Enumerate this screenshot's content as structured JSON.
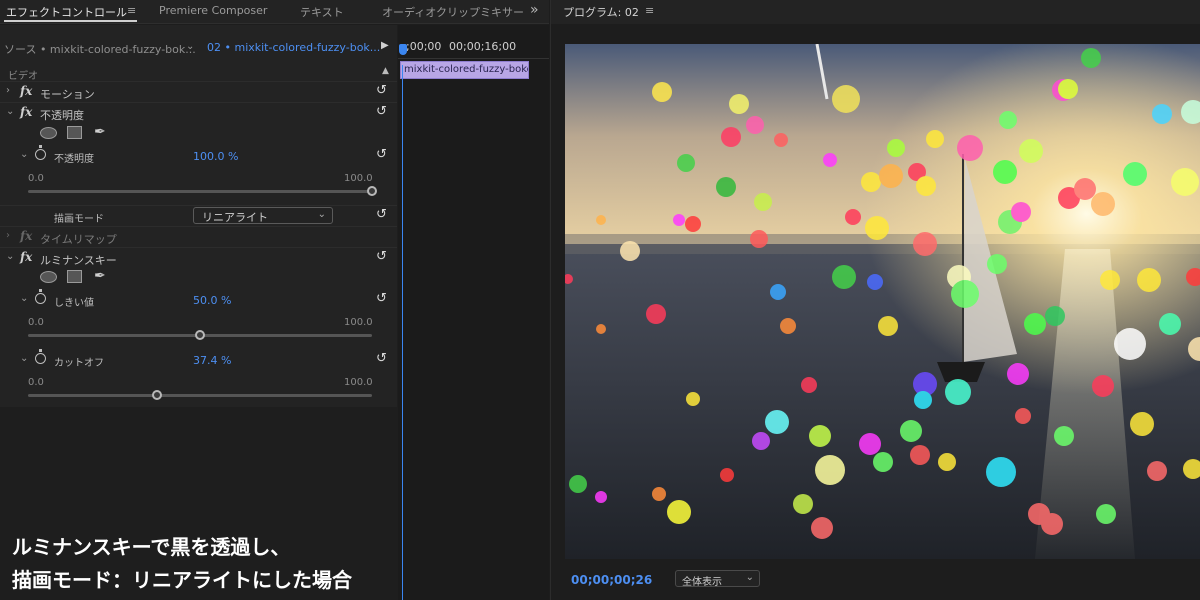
{
  "tabs": [
    {
      "label": "エフェクトコントロール",
      "active": true
    },
    {
      "label": "Premiere Composer",
      "active": false
    },
    {
      "label": "テキスト",
      "active": false
    },
    {
      "label": "オーディオクリップミキサー",
      "active": false
    }
  ],
  "icons": {
    "menu": "≡",
    "more": "»",
    "play": "▶",
    "reset": "↺",
    "chevron_down": "⌄",
    "chevron_right": "›",
    "pen": "✒"
  },
  "effects": {
    "source_label": "ソース • mixkit-colored-fuzzy-bok...",
    "sequence_label": "02 • mixkit-colored-fuzzy-bok...",
    "section_video": "ビデオ",
    "motion": "モーション",
    "opacity": {
      "title": "不透明度",
      "param": "不透明度",
      "value": "100.0 %",
      "slider": {
        "min": "0.0",
        "max": "100.0",
        "fraction": 1.0
      },
      "blend_label": "描画モード",
      "blend_value": "リニアライト"
    },
    "time_remap": "タイムリマップ",
    "luma_key": {
      "title": "ルミナンスキー",
      "threshold_label": "しきい値",
      "threshold_value": "50.0 %",
      "threshold_slider": {
        "min": "0.0",
        "max": "100.0",
        "fraction": 0.5
      },
      "cutoff_label": "カットオフ",
      "cutoff_value": "37.4 %",
      "cutoff_slider": {
        "min": "0.0",
        "max": "100.0",
        "fraction": 0.374
      }
    }
  },
  "timeline": {
    "timecode_start": ";00;00",
    "timecode_mid": "00;00;16;00",
    "clip_name": "mixkit-colored-fuzzy-boke"
  },
  "caption": {
    "line1": "ルミナンスキーで黒を透過し、",
    "line2": "描画モード：リニアライトにした場合"
  },
  "program": {
    "title": "プログラム: 02",
    "timecode": "00;00;00;26",
    "zoom": "全体表示"
  },
  "colors": {
    "accent_blue": "#4d8ff2",
    "clip": "#b8a6e6",
    "playhead": "#3b86f0"
  }
}
